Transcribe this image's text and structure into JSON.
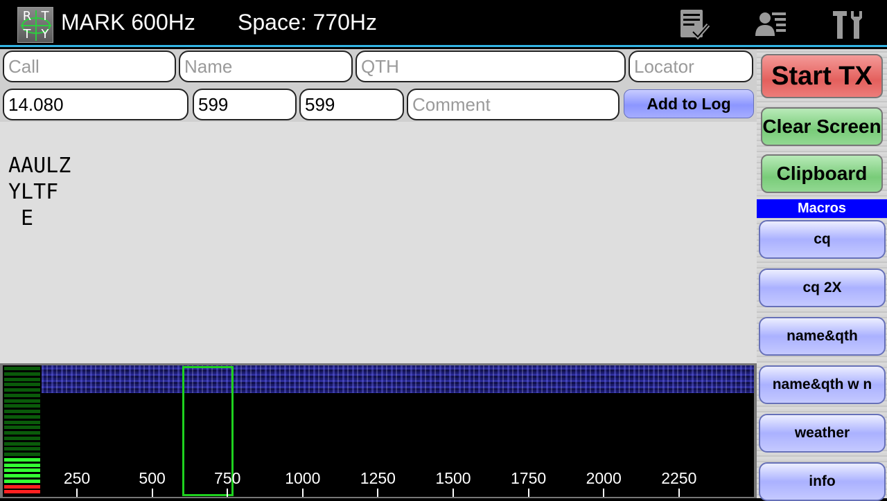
{
  "app": {
    "logo_letters": [
      "R",
      "T",
      "T",
      "Y"
    ],
    "mark": "MARK 600Hz",
    "space": "Space: 770Hz"
  },
  "actionbar": {
    "icons": [
      "checklist-icon",
      "contacts-icon",
      "tools-icon"
    ]
  },
  "log_form": {
    "call_placeholder": "Call",
    "name_placeholder": "Name",
    "qth_placeholder": "QTH",
    "locator_placeholder": "Locator",
    "frequency": "14.080",
    "rst_sent": "599",
    "rst_received": "599",
    "comment_placeholder": "Comment",
    "add_to_log": "Add to Log"
  },
  "rx_text": "AAULZ\nYLTF\n E",
  "waterfall": {
    "ticks": [
      "250",
      "500",
      "750",
      "1000",
      "1250",
      "1500",
      "1750",
      "2000",
      "2250"
    ],
    "colors": {
      "band": "#2c2c9a",
      "tuner": "#1fd11f",
      "meter_low": "#33ff33",
      "meter_high": "#ff2020",
      "meter_dim": "#0a5a0a"
    }
  },
  "side": {
    "start_tx": "Start TX",
    "clear_screen": "Clear Screen",
    "clipboard": "Clipboard",
    "macros_header": "Macros",
    "macros": [
      "cq",
      "cq 2X",
      "name&qth",
      "name&qth w n",
      "weather",
      "info"
    ]
  },
  "colors": {
    "accent": "#33b5e5",
    "start_tx": "#e4605d",
    "green_button": "#79cc79",
    "macro_button": "#aab1ff",
    "macros_header": "#0000ff"
  }
}
